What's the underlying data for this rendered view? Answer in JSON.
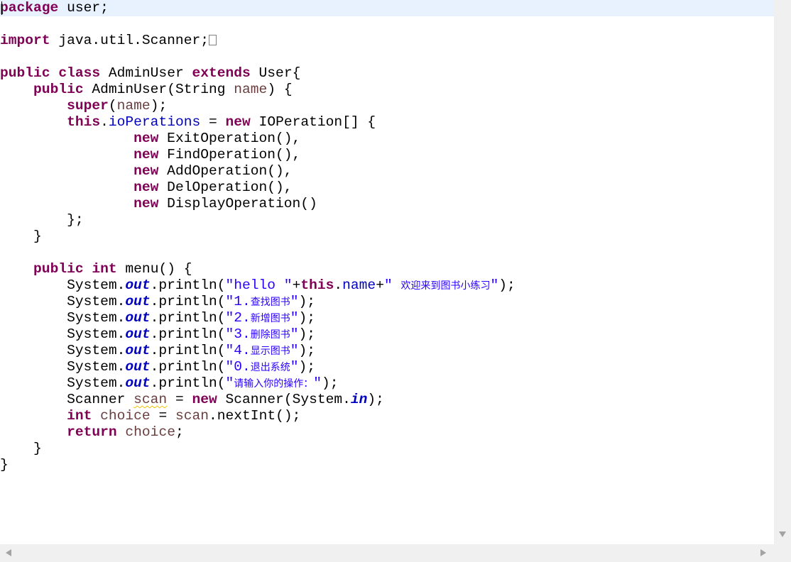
{
  "editor": {
    "language": "java",
    "current_line": 0,
    "colors": {
      "keyword": "#7f0055",
      "field": "#0000c0",
      "string": "#2a00ff",
      "local_variable": "#6a3e3e",
      "warning_underline": "#f2c200",
      "current_line_bg": "#e8f2fe"
    },
    "lines": [
      [
        [
          "kw",
          "package"
        ],
        [
          "plain",
          " user;"
        ]
      ],
      [],
      [
        [
          "kw",
          "import"
        ],
        [
          "plain",
          " java.util.Scanner;"
        ],
        [
          "fold",
          ""
        ]
      ],
      [],
      [
        [
          "kw",
          "public"
        ],
        [
          "plain",
          " "
        ],
        [
          "kw",
          "class"
        ],
        [
          "plain",
          " AdminUser "
        ],
        [
          "kw",
          "extends"
        ],
        [
          "plain",
          " User{"
        ]
      ],
      [
        [
          "plain",
          "    "
        ],
        [
          "kw",
          "public"
        ],
        [
          "plain",
          " AdminUser(String "
        ],
        [
          "local",
          "name"
        ],
        [
          "plain",
          ") {"
        ]
      ],
      [
        [
          "plain",
          "        "
        ],
        [
          "kw",
          "super"
        ],
        [
          "plain",
          "("
        ],
        [
          "local",
          "name"
        ],
        [
          "plain",
          ");"
        ]
      ],
      [
        [
          "plain",
          "        "
        ],
        [
          "kw",
          "this"
        ],
        [
          "plain",
          "."
        ],
        [
          "field",
          "ioPerations"
        ],
        [
          "plain",
          " = "
        ],
        [
          "kw",
          "new"
        ],
        [
          "plain",
          " IOPeration[] {"
        ]
      ],
      [
        [
          "plain",
          "                "
        ],
        [
          "kw",
          "new"
        ],
        [
          "plain",
          " ExitOperation(),"
        ]
      ],
      [
        [
          "plain",
          "                "
        ],
        [
          "kw",
          "new"
        ],
        [
          "plain",
          " FindOperation(),"
        ]
      ],
      [
        [
          "plain",
          "                "
        ],
        [
          "kw",
          "new"
        ],
        [
          "plain",
          " AddOperation(),"
        ]
      ],
      [
        [
          "plain",
          "                "
        ],
        [
          "kw",
          "new"
        ],
        [
          "plain",
          " DelOperation(),"
        ]
      ],
      [
        [
          "plain",
          "                "
        ],
        [
          "kw",
          "new"
        ],
        [
          "plain",
          " DisplayOperation()"
        ]
      ],
      [
        [
          "plain",
          "        };"
        ]
      ],
      [
        [
          "plain",
          "    }"
        ]
      ],
      [],
      [
        [
          "plain",
          "    "
        ],
        [
          "kw",
          "public"
        ],
        [
          "plain",
          " "
        ],
        [
          "kw",
          "int"
        ],
        [
          "plain",
          " menu() {"
        ]
      ],
      [
        [
          "plain",
          "        System."
        ],
        [
          "static",
          "out"
        ],
        [
          "plain",
          ".println("
        ],
        [
          "str",
          "\"hello \""
        ],
        [
          "plain",
          "+"
        ],
        [
          "kw",
          "this"
        ],
        [
          "plain",
          "."
        ],
        [
          "field",
          "name"
        ],
        [
          "plain",
          "+"
        ],
        [
          "str",
          "\" "
        ],
        [
          "str cjk",
          "欢迎来到图书小练习"
        ],
        [
          "str",
          "\""
        ],
        [
          "plain",
          ");"
        ]
      ],
      [
        [
          "plain",
          "        System."
        ],
        [
          "static",
          "out"
        ],
        [
          "plain",
          ".println("
        ],
        [
          "str",
          "\"1."
        ],
        [
          "str cjk",
          "查找图书"
        ],
        [
          "str",
          "\""
        ],
        [
          "plain",
          ");"
        ]
      ],
      [
        [
          "plain",
          "        System."
        ],
        [
          "static",
          "out"
        ],
        [
          "plain",
          ".println("
        ],
        [
          "str",
          "\"2."
        ],
        [
          "str cjk",
          "新增图书"
        ],
        [
          "str",
          "\""
        ],
        [
          "plain",
          ");"
        ]
      ],
      [
        [
          "plain",
          "        System."
        ],
        [
          "static",
          "out"
        ],
        [
          "plain",
          ".println("
        ],
        [
          "str",
          "\"3."
        ],
        [
          "str cjk",
          "删除图书"
        ],
        [
          "str",
          "\""
        ],
        [
          "plain",
          ");"
        ]
      ],
      [
        [
          "plain",
          "        System."
        ],
        [
          "static",
          "out"
        ],
        [
          "plain",
          ".println("
        ],
        [
          "str",
          "\"4."
        ],
        [
          "str cjk",
          "显示图书"
        ],
        [
          "str",
          "\""
        ],
        [
          "plain",
          ");"
        ]
      ],
      [
        [
          "plain",
          "        System."
        ],
        [
          "static",
          "out"
        ],
        [
          "plain",
          ".println("
        ],
        [
          "str",
          "\"0."
        ],
        [
          "str cjk",
          "退出系统"
        ],
        [
          "str",
          "\""
        ],
        [
          "plain",
          ");"
        ]
      ],
      [
        [
          "plain",
          "        System."
        ],
        [
          "static",
          "out"
        ],
        [
          "plain",
          ".println("
        ],
        [
          "str",
          "\""
        ],
        [
          "str cjk",
          "请输入你的操作："
        ],
        [
          "str",
          "\""
        ],
        [
          "plain",
          ");"
        ]
      ],
      [
        [
          "plain",
          "        Scanner "
        ],
        [
          "local warn",
          "scan"
        ],
        [
          "plain",
          " = "
        ],
        [
          "kw",
          "new"
        ],
        [
          "plain",
          " Scanner(System."
        ],
        [
          "static",
          "in"
        ],
        [
          "plain",
          ");"
        ]
      ],
      [
        [
          "plain",
          "        "
        ],
        [
          "kw",
          "int"
        ],
        [
          "plain",
          " "
        ],
        [
          "local",
          "choice"
        ],
        [
          "plain",
          " = "
        ],
        [
          "local",
          "scan"
        ],
        [
          "plain",
          ".nextInt();"
        ]
      ],
      [
        [
          "plain",
          "        "
        ],
        [
          "kw",
          "return"
        ],
        [
          "plain",
          " "
        ],
        [
          "local",
          "choice"
        ],
        [
          "plain",
          ";"
        ]
      ],
      [
        [
          "plain",
          "    }"
        ]
      ],
      [
        [
          "plain",
          "}"
        ]
      ]
    ]
  },
  "scrollbars": {
    "vertical_icon": "arrow-down-icon",
    "horizontal_icons": [
      "arrow-left-icon",
      "arrow-right-icon"
    ]
  }
}
